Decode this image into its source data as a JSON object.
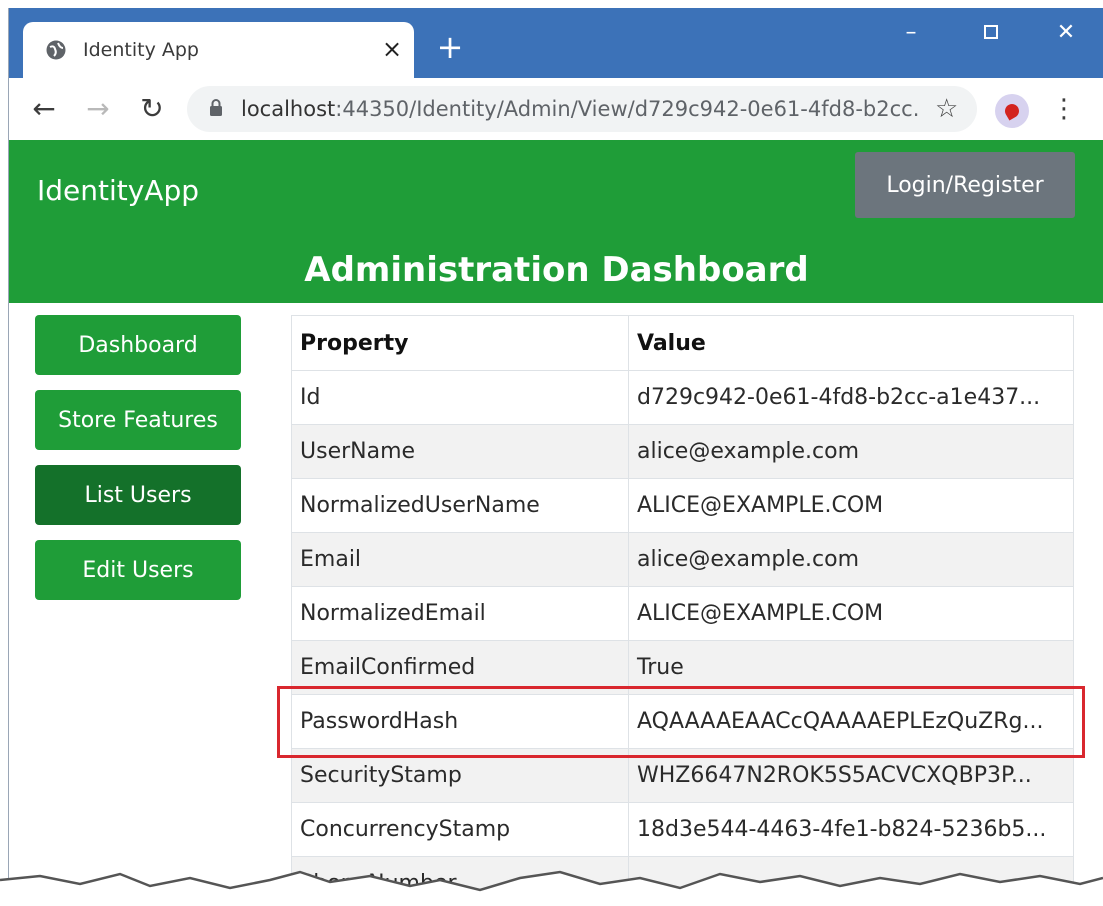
{
  "browser": {
    "tab_title": "Identity App",
    "tab_close": "×",
    "new_tab": "+",
    "url_host": "localhost",
    "url_rest": ":44350/Identity/Admin/View/d729c942-0e61-4fd8-b2cc..."
  },
  "app": {
    "brand": "IdentityApp",
    "login_label": "Login/Register",
    "page_title": "Administration Dashboard"
  },
  "sidebar": {
    "items": [
      {
        "label": "Dashboard",
        "active": false
      },
      {
        "label": "Store Features",
        "active": false
      },
      {
        "label": "List Users",
        "active": true
      },
      {
        "label": "Edit Users",
        "active": false
      }
    ]
  },
  "table": {
    "headers": [
      "Property",
      "Value"
    ],
    "rows": [
      {
        "property": "Id",
        "value": "d729c942-0e61-4fd8-b2cc-a1e437..."
      },
      {
        "property": "UserName",
        "value": "alice@example.com"
      },
      {
        "property": "NormalizedUserName",
        "value": "ALICE@EXAMPLE.COM"
      },
      {
        "property": "Email",
        "value": "alice@example.com"
      },
      {
        "property": "NormalizedEmail",
        "value": "ALICE@EXAMPLE.COM"
      },
      {
        "property": "EmailConfirmed",
        "value": "True"
      },
      {
        "property": "PasswordHash",
        "value": "AQAAAAEAACcQAAAAEPLEzQuZRg..."
      },
      {
        "property": "SecurityStamp",
        "value": "WHZ6647N2ROK5S5ACVCXQBP3P..."
      },
      {
        "property": "ConcurrencyStamp",
        "value": "18d3e544-4463-4fe1-b824-5236b5..."
      },
      {
        "property": "PhoneNumber",
        "value": ""
      }
    ],
    "highlighted_row": "PasswordHash"
  },
  "colors": {
    "brand_green": "#1f9d38",
    "active_green": "#14712a",
    "login_gray": "#6c757d",
    "tabbar_blue": "#3c72b8",
    "highlight_red": "#d9272e"
  }
}
